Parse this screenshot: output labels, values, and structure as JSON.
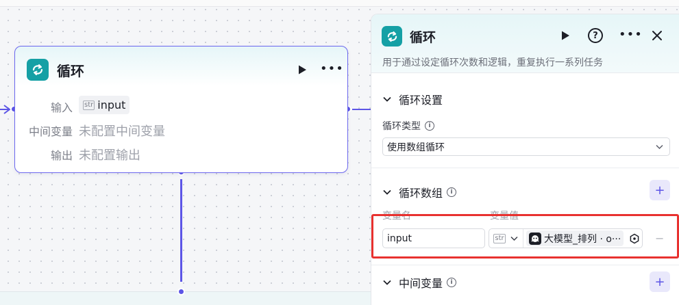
{
  "node": {
    "title": "循环",
    "rows": [
      {
        "label": "输入",
        "value": "input",
        "type_badge": "str"
      },
      {
        "label": "中间变量",
        "value": "未配置中间变量"
      },
      {
        "label": "输出",
        "value": "未配置输出"
      }
    ]
  },
  "panel": {
    "title": "循环",
    "description": "用于通过设定循环次数和逻辑，重复执行一系列任务",
    "help_symbol": "?",
    "loop_settings": {
      "title": "循环设置",
      "type_label": "循环类型",
      "type_value": "使用数组循环"
    },
    "loop_array": {
      "title": "循环数组",
      "col_name": "变量名",
      "col_value": "变量值",
      "var_name": "input",
      "type_badge": "str",
      "value_ref": "大模型_排列 · o···"
    },
    "intermediate": {
      "title": "中间变量"
    },
    "add_symbol": "+",
    "remove_symbol": "−",
    "info_symbol": "i"
  },
  "colors": {
    "accent": "#5c55e6",
    "node_icon": "#15a0a5",
    "highlight": "#e8312f"
  }
}
